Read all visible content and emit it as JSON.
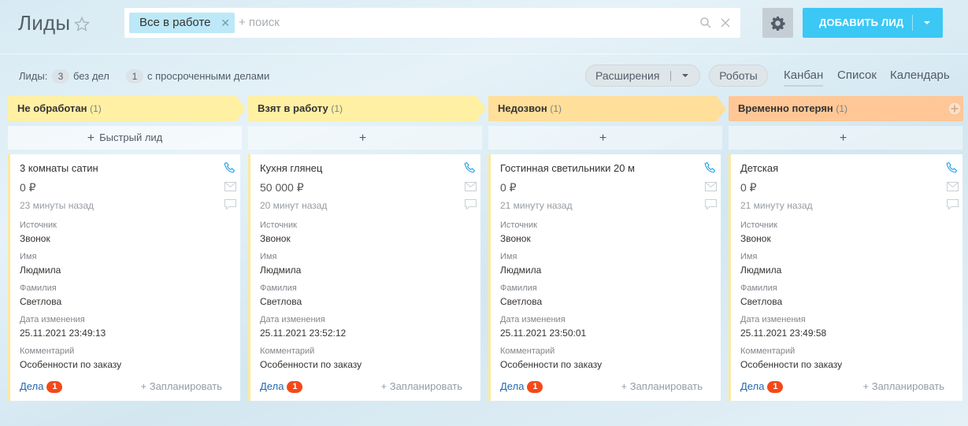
{
  "header": {
    "title": "Лиды",
    "filter_chip": "Все в работе",
    "search_placeholder": "+ поиск",
    "add_button": "ДОБАВИТЬ ЛИД"
  },
  "stats": {
    "leads_label": "Лиды:",
    "no_deals_count": "3",
    "no_deals_label": "без дел",
    "overdue_count": "1",
    "overdue_label": "с просроченными делами"
  },
  "toolbar": {
    "extensions": "Расширения",
    "robots": "Роботы",
    "views": [
      "Канбан",
      "Список",
      "Календарь"
    ]
  },
  "columns": [
    {
      "name": "Не обработан",
      "count": "(1)",
      "color": "#fff0a3",
      "add_label": "Быстрый лид",
      "card": {
        "title": "3 комнаты сатин",
        "price": "0 ₽",
        "time": "23 минуты назад",
        "source": "Звонок",
        "first_name": "Людмила",
        "last_name": "Светлова",
        "modified": "25.11.2021 23:49:13",
        "comment": "Особенности по заказу"
      }
    },
    {
      "name": "Взят в работу",
      "count": "(1)",
      "color": "#fff0a3",
      "add_label": "",
      "card": {
        "title": "Кухня глянец",
        "price": "50 000 ₽",
        "time": "20 минут назад",
        "source": "Звонок",
        "first_name": "Людмила",
        "last_name": "Светлова",
        "modified": "25.11.2021 23:52:12",
        "comment": "Особенности по заказу"
      }
    },
    {
      "name": "Недозвон",
      "count": "(1)",
      "color": "#ffdf99",
      "add_label": "",
      "card": {
        "title": "Гостинная светильники 20 м",
        "price": "0 ₽",
        "time": "21 минуту назад",
        "source": "Звонок",
        "first_name": "Людмила",
        "last_name": "Светлова",
        "modified": "25.11.2021 23:50:01",
        "comment": "Особенности по заказу"
      }
    },
    {
      "name": "Временно потерян",
      "count": "(1)",
      "color": "#ffc796",
      "add_label": "",
      "card": {
        "title": "Детская",
        "price": "0 ₽",
        "time": "21 минуту назад",
        "source": "Звонок",
        "first_name": "Людмила",
        "last_name": "Светлова",
        "modified": "25.11.2021 23:49:58",
        "comment": "Особенности по заказу"
      }
    }
  ],
  "field_labels": {
    "source": "Источник",
    "first_name": "Имя",
    "last_name": "Фамилия",
    "modified": "Дата изменения",
    "comment": "Комментарий"
  },
  "card_footer": {
    "deals": "Дела",
    "deals_badge": "1",
    "plan": "+ Запланировать"
  },
  "colors": {
    "accent": "#3bc8f5",
    "badge": "#f54819",
    "link": "#2067b0"
  }
}
